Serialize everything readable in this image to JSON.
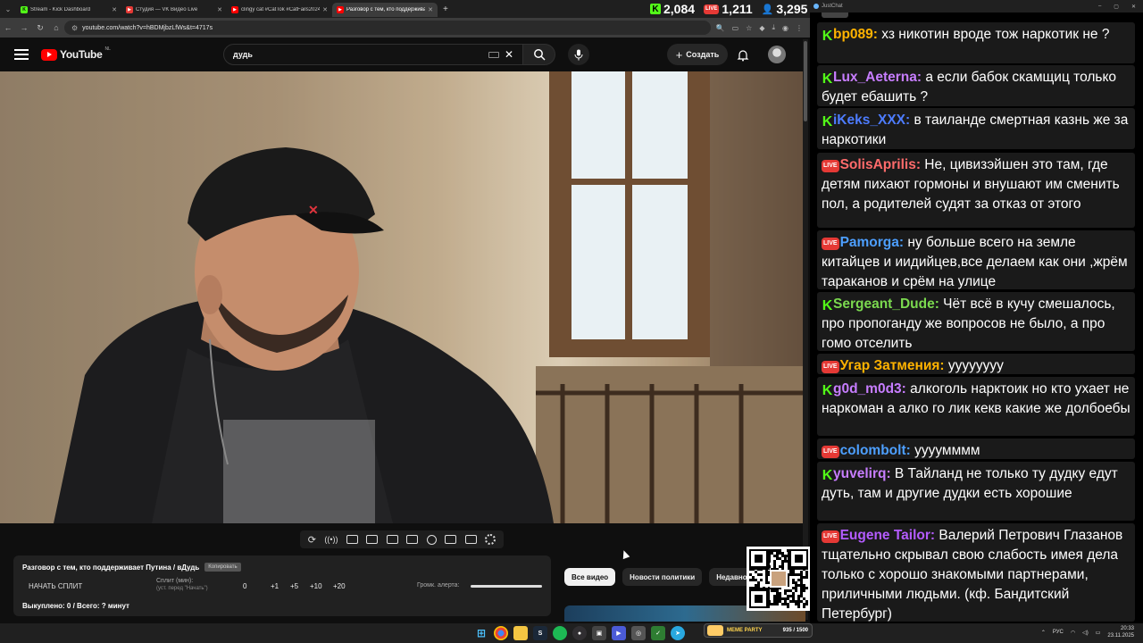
{
  "browser": {
    "tabs": [
      {
        "title": "Stream - Kick Dashboard",
        "favicon_color": "#53fc18",
        "active": false
      },
      {
        "title": "Студия — VK Видео Live",
        "favicon_color": "#e53935",
        "active": false
      },
      {
        "title": "clingy cat #CatTok #CatFails2024",
        "favicon_color": "#ff0000",
        "active": false
      },
      {
        "title": "Разговор с тем, кто поддерживает",
        "favicon_color": "#ff0000",
        "active": true
      }
    ],
    "url": "youtube.com/watch?v=hBDMjbzLfWs&t=4717s"
  },
  "stream_stats": {
    "kick_viewers": "2,084",
    "vk_viewers": "1,211",
    "total_viewers": "3,295"
  },
  "youtube": {
    "logo_text": "YouTube",
    "region": "NL",
    "search_query": "дудь",
    "create_label": "Создать"
  },
  "split_panel": {
    "title": "Разговор с тем, кто поддерживает Путина / вДудь",
    "copy_label": "Копировать",
    "start_label": "НАЧАТЬ СПЛИТ",
    "split_label": "Сплит (мин):",
    "split_hint": "(уст. перед \"Начать\")",
    "split_value": "0",
    "increments": [
      "+1",
      "+5",
      "+10",
      "+20"
    ],
    "volume_label": "Громк. алерта:",
    "bought": "Выкуплено: 0 / Всего: ? минут"
  },
  "chips": [
    "Все видео",
    "Новости политики",
    "Недавно опубликованные"
  ],
  "chat": {
    "window_title": "JustChat",
    "messages": [
      {
        "platform": "kick",
        "nick": "bp089:",
        "color": "#ffb300",
        "text": " хз никотин вроде тож наркотик не ?"
      },
      {
        "platform": "kick",
        "nick": "Lux_Aeterna:",
        "color": "#c77dff",
        "text": " а если бабок скамщиц только будет ебашить ?"
      },
      {
        "platform": "kick",
        "nick": "iKeks_XXX:",
        "color": "#4d7cff",
        "text": " в таиланде смертная казнь же за наркотики"
      },
      {
        "platform": "vk",
        "nick": "SolisAprilis:",
        "color": "#ff6b6b",
        "text": " Не, цивизэйшен это там, где детям пихают гормоны и внушают им сменить пол, а родителей судят за отказ от этого"
      },
      {
        "platform": "vk",
        "nick": "Pamorga:",
        "color": "#4d9fff",
        "text": " ну больше всего на земле китайцев и иидийцев,все делаем как они ,жрём тараканов и срём на улице"
      },
      {
        "platform": "kick",
        "nick": "Sergeant_Dude:",
        "color": "#7bd94f",
        "text": " Чёт всё в кучу смешалось, про пропоганду же вопросов не было, а про гомо отселить"
      },
      {
        "platform": "vk",
        "nick": "Угар Затмения:",
        "color": "#ffb300",
        "text": " уууууууу"
      },
      {
        "platform": "kick",
        "nick": "g0d_m0d3:",
        "color": "#c77dff",
        "text": " алкоголь нарктоик но кто ухает не наркоман а алко го лик кекв какие же долбоебы"
      },
      {
        "platform": "vk",
        "nick": "colombolt:",
        "color": "#4d9fff",
        "text": " уууумммм"
      },
      {
        "platform": "kick",
        "nick": "yuvelirq:",
        "color": "#c77dff",
        "text": " В Тайланд не только ту дудку едут дуть, там и другие дудки есть хорошие"
      },
      {
        "platform": "vk",
        "nick": "Eugene Tailor:",
        "color": "#b45cff",
        "text": " Валерий Петрович Глазанов тщательно скрывал свою слабость имея дела только с хорошо знакомыми партнерами, приличными людьми. (кф. Бандитский Петербург)"
      }
    ]
  },
  "taskbar": {
    "meme_label": "MEME PARTY",
    "meme_count": "935 / 1500",
    "lang": "РУС",
    "time": "20:33",
    "date": "23.11.2025"
  },
  "colors": {
    "youtube_red": "#ff0000",
    "kick_green": "#53fc18",
    "vk_live_red": "#e53935"
  }
}
